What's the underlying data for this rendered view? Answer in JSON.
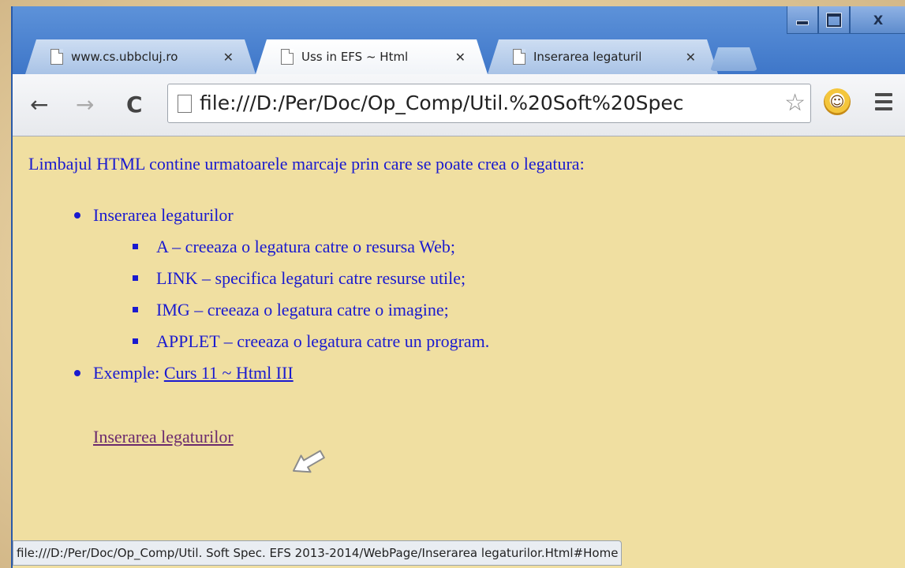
{
  "window": {
    "controls": {
      "minimize": "minimize",
      "maximize": "maximize",
      "close": "X"
    }
  },
  "tabs": [
    {
      "title": "www.cs.ubbcluj.ro",
      "active": false
    },
    {
      "title": "Uss in EFS ~ Html",
      "active": true
    },
    {
      "title": "Inserarea legaturil",
      "active": false
    }
  ],
  "toolbar": {
    "back": "←",
    "forward": "→",
    "reload": "C",
    "url": "file:///D:/Per/Doc/Op_Comp/Util.%20Soft%20Spec",
    "star": "☆",
    "menu": "menu"
  },
  "content": {
    "intro": "Limbajul HTML contine urmatoarele marcaje prin care se poate crea o legatura:",
    "list": [
      {
        "label": "Inserarea legaturilor",
        "subitems": [
          "A – creeaza o legatura catre o resursa Web;",
          "LINK – specifica legaturi catre resurse utile;",
          "IMG – creeaza o legatura catre o imagine;",
          "APPLET – creeaza o legatura catre un program."
        ]
      },
      {
        "label_prefix": "Exemple: ",
        "link": "Curs 11 ~ Html III"
      }
    ],
    "standalone_link": "Inserarea legaturilor"
  },
  "status": "file:///D:/Per/Doc/Op_Comp/Util. Soft Spec. EFS 2013-2014/WebPage/Inserarea legaturilor.Html#Home",
  "colors": {
    "content_bg": "#f0dfa1",
    "text": "#1a1acf",
    "visited_link": "#6b2a6e",
    "frame": "#3f76c8"
  }
}
